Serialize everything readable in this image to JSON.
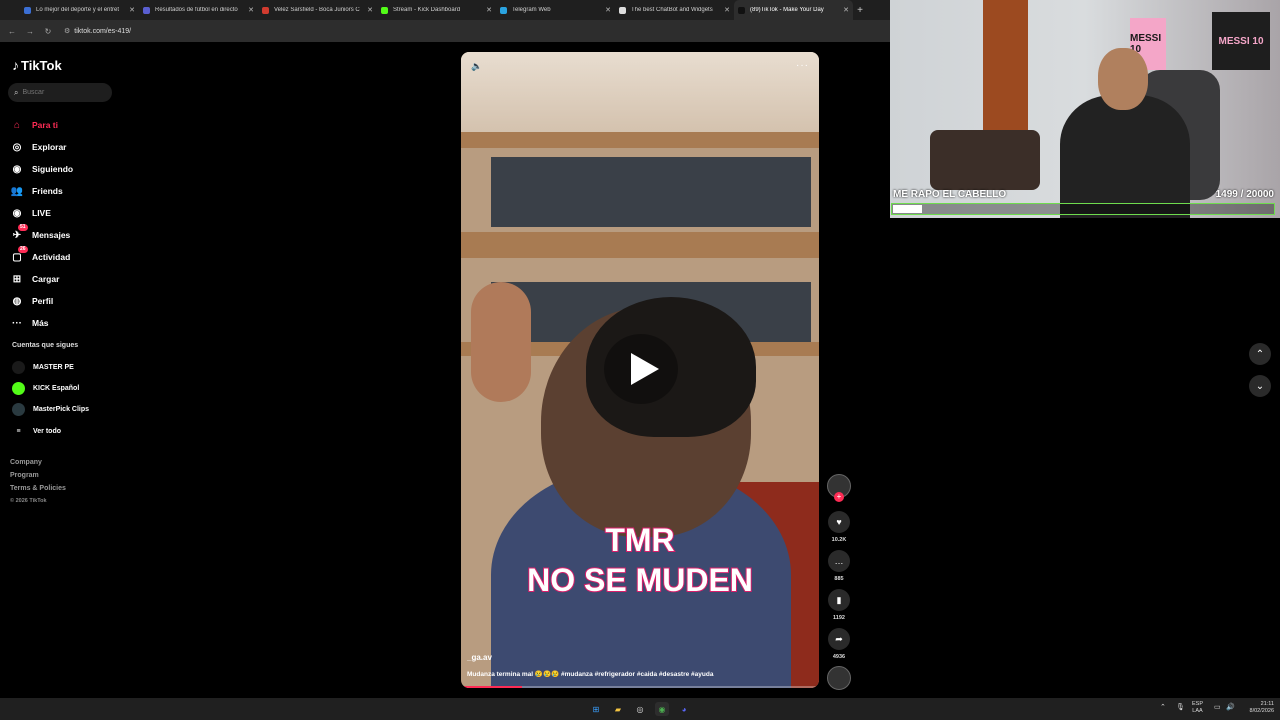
{
  "browser": {
    "tabs": [
      {
        "label": "Lo mejor del deporte y el entret",
        "color": "#3b6fd4",
        "active": false
      },
      {
        "label": "Resultados de fútbol en directo",
        "color": "#5a5fd1",
        "active": false
      },
      {
        "label": "Velez Sarsfield - Boca Juniors C",
        "color": "#d13b2f",
        "active": false
      },
      {
        "label": "Stream - Kick Dashboard",
        "color": "#53fc18",
        "active": false
      },
      {
        "label": "Telegram Web",
        "color": "#2aa3e0",
        "active": false
      },
      {
        "label": "The best ChatBot and Widgets",
        "color": "#dddddd",
        "active": false
      },
      {
        "label": "(89)TikTok - Make Your Day",
        "color": "#111111",
        "active": true
      }
    ],
    "url": "tiktok.com/es-419/"
  },
  "sidebar": {
    "logo": "TikTok",
    "search_placeholder": "Buscar",
    "nav": [
      {
        "label": "Para ti",
        "icon": "home-icon",
        "glyph": "⌂",
        "active": true
      },
      {
        "label": "Explorar",
        "icon": "compass-icon",
        "glyph": "◎",
        "active": false
      },
      {
        "label": "Siguiendo",
        "icon": "following-icon",
        "glyph": "◉",
        "active": false
      },
      {
        "label": "Friends",
        "icon": "friends-icon",
        "glyph": "👥",
        "active": false
      },
      {
        "label": "LIVE",
        "icon": "live-icon",
        "glyph": "◉",
        "active": false
      },
      {
        "label": "Mensajes",
        "icon": "messages-icon",
        "glyph": "✈",
        "active": false,
        "badge": "51"
      },
      {
        "label": "Actividad",
        "icon": "activity-icon",
        "glyph": "▢",
        "active": false,
        "badge": "26"
      },
      {
        "label": "Cargar",
        "icon": "upload-icon",
        "glyph": "⊞",
        "active": false
      },
      {
        "label": "Perfil",
        "icon": "profile-icon",
        "glyph": "◍",
        "active": false
      },
      {
        "label": "Más",
        "icon": "more-icon",
        "glyph": "···",
        "active": false
      }
    ],
    "following_title": "Cuentas que sigues",
    "following": [
      {
        "label": "MASTER PE",
        "color": "#1a1a1a"
      },
      {
        "label": "KICK Español",
        "color": "#53fc18"
      },
      {
        "label": "MasterPick Clips",
        "color": "#2a3a40"
      },
      {
        "label": "Ver todo",
        "color": "#000000"
      }
    ],
    "footer": [
      "Company",
      "Program",
      "Terms & Policies"
    ],
    "copyright": "© 2026 TikTok"
  },
  "video": {
    "caption_line1": "TMR",
    "caption_line2": "NO SE MUDEN",
    "author": "_ga.av",
    "description": "Mudanza termina mal 😢😢😢 #mudanza #refrigerador #caida #desastre #ayuda",
    "progress": 0.17
  },
  "actions": {
    "likes": "10.2K",
    "comments": "885",
    "saves": "1192",
    "shares": "4936"
  },
  "stream_overlay": {
    "goal_title": "ME RAPO EL CABELLO",
    "goal_count": "1499  / 20000",
    "goal_progress": 0.075,
    "poster_left": "MESSI 10",
    "poster_right": "MESSI 10"
  },
  "taskbar": {
    "lang_top": "ESP",
    "lang_bottom": "LAA",
    "time": "21:11",
    "date": "8/02/2026"
  }
}
